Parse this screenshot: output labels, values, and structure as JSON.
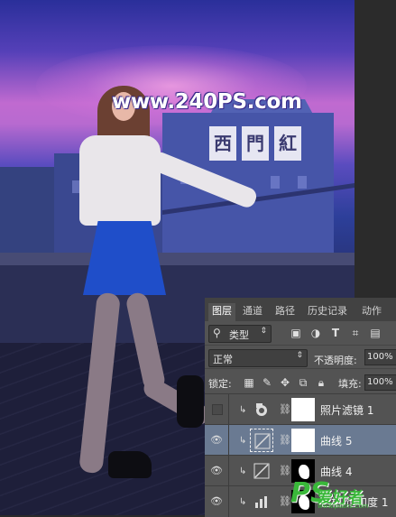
{
  "photo": {
    "watermark": "www.240PS.com",
    "sign_chars": [
      "西",
      "門",
      "紅"
    ]
  },
  "layers_panel": {
    "tabs": [
      {
        "label": "图层",
        "active": true
      },
      {
        "label": "通道",
        "active": false
      },
      {
        "label": "路径",
        "active": false
      },
      {
        "label": "历史记录",
        "active": false
      },
      {
        "label": "动作",
        "active": false
      }
    ],
    "filter": {
      "kind_label": "类型",
      "filter_icons": [
        "image-filter-icon",
        "adjustment-filter-icon",
        "type-filter-icon",
        "shape-filter-icon",
        "smartobject-filter-icon"
      ]
    },
    "blend_mode": "正常",
    "opacity_label": "不透明度:",
    "opacity_value": "100%",
    "lock_label": "锁定:",
    "fill_label": "填充:",
    "fill_value": "100%",
    "layers": [
      {
        "name": "照片滤镜 1",
        "visible": false,
        "selected": false,
        "type": "photo-filter"
      },
      {
        "name": "曲线 5",
        "visible": true,
        "selected": true,
        "type": "curves"
      },
      {
        "name": "曲线 4",
        "visible": true,
        "selected": false,
        "type": "curves"
      },
      {
        "name": "色相/饱和度 1",
        "visible": true,
        "selected": false,
        "type": "hue-saturation"
      }
    ]
  },
  "logo": {
    "mark": "PS",
    "text": "爱好者",
    "url": "www.psahz.com"
  }
}
